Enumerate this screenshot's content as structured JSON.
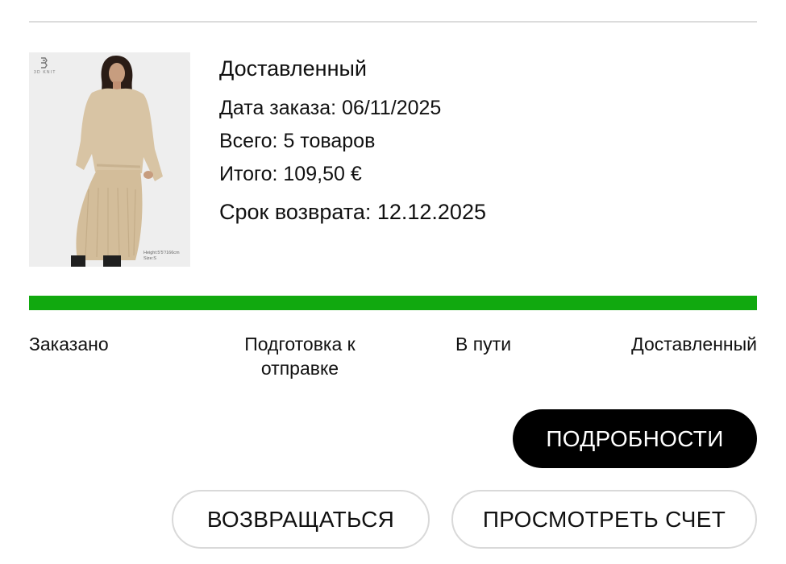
{
  "order": {
    "status": "Доставленный",
    "order_date": "Дата заказа: 06/11/2025",
    "items_count": "Всего: 5 товаров",
    "total": "Итого: 109,50 €",
    "return_deadline": "Срок возврата: 12.12.2025"
  },
  "product_image": {
    "brand": "3D KNIT",
    "model_caption_line1": "Height:5'5\"/166cm",
    "model_caption_line2": "Size:S",
    "colors": {
      "knit": "#d8c4a4",
      "hair": "#2a1c16",
      "boots": "#1f1f1f"
    }
  },
  "progress": {
    "fraction": 1.0,
    "color": "#11a90f",
    "steps": [
      {
        "label": "Заказано"
      },
      {
        "label_line1": "Подготовка к",
        "label_line2": "отправке"
      },
      {
        "label": "В пути"
      },
      {
        "label": "Доставленный"
      }
    ]
  },
  "actions": {
    "details": "ПОДРОБНОСТИ",
    "return": "ВОЗВРАЩАТЬСЯ",
    "view_invoice": "ПРОСМОТРЕТЬ СЧЕТ"
  }
}
